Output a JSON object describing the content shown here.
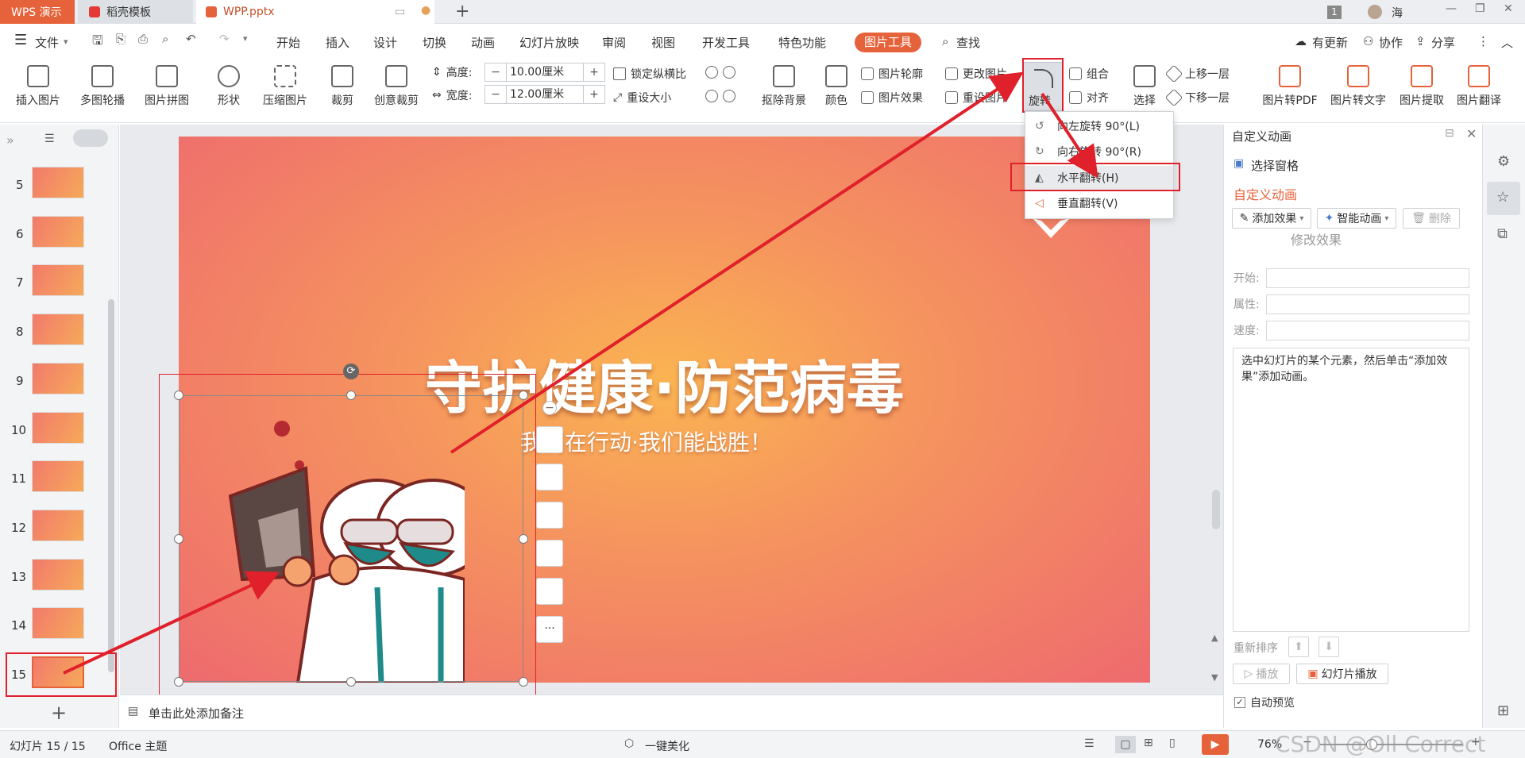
{
  "tabs": {
    "wps": "WPS 演示",
    "template": "稻壳模板",
    "doc": "WPP.pptx"
  },
  "titlebar": {
    "badge": "1",
    "user": "海"
  },
  "menu": {
    "file": "文件",
    "items": [
      "开始",
      "插入",
      "设计",
      "切换",
      "动画",
      "幻灯片放映",
      "审阅",
      "视图",
      "开发工具",
      "特色功能"
    ],
    "picture_tools": "图片工具",
    "search": "查找",
    "update": "有更新",
    "collab": "协作",
    "share": "分享"
  },
  "ribbon": {
    "insert_pic": "插入图片",
    "multi_carousel": "多图轮播",
    "pic_collage": "图片拼图",
    "shape": "形状",
    "compress": "压缩图片",
    "crop": "裁剪",
    "creative_crop": "创意裁剪",
    "height_label": "高度:",
    "height_value": "10.00厘米",
    "width_label": "宽度:",
    "width_value": "12.00厘米",
    "lock_ratio": "锁定纵横比",
    "reset_size": "重设大小",
    "remove_bg": "抠除背景",
    "color": "颜色",
    "pic_outline": "图片轮廓",
    "pic_effect": "图片效果",
    "change_pic": "更改图片",
    "reset_pic": "重设图片",
    "rotate": "旋转",
    "group": "组合",
    "align": "对齐",
    "select": "选择",
    "bring_forward": "上移一层",
    "send_backward": "下移一层",
    "to_pdf": "图片转PDF",
    "to_text": "图片转文字",
    "extract": "图片提取",
    "translate": "图片翻译"
  },
  "rotate_menu": {
    "left": "向左旋转 90°(L)",
    "right": "向右旋转 90°(R)",
    "flip_h": "水平翻转(H)",
    "flip_v": "垂直翻转(V)"
  },
  "thumbnails": [
    "5",
    "6",
    "7",
    "8",
    "9",
    "10",
    "11",
    "12",
    "13",
    "14",
    "15"
  ],
  "slide": {
    "title": "守护健康·防范病毒",
    "subtitle": "我们在行动·我们能战胜！"
  },
  "notes": {
    "placeholder": "单击此处添加备注"
  },
  "right_panel": {
    "header": "自定义动画",
    "selection_pane": "选择窗格",
    "section": "自定义动画",
    "add_effect": "添加效果",
    "smart_anim": "智能动画",
    "delete": "删除",
    "modify": "修改效果",
    "start": "开始:",
    "property": "属性:",
    "speed": "速度:",
    "hint": "选中幻灯片的某个元素，然后单击“添加效果”添加动画。",
    "reorder": "重新排序",
    "play": "播放",
    "slideshow": "幻灯片播放",
    "auto_preview": "自动预览"
  },
  "status": {
    "slide_count": "幻灯片 15 / 15",
    "theme": "Office 主题",
    "beautify": "一键美化",
    "zoom": "76%",
    "watermark": "CSDN @Oll Correct"
  },
  "colors": {
    "accent": "#e5623a",
    "annotation_red": "#e0202a"
  }
}
